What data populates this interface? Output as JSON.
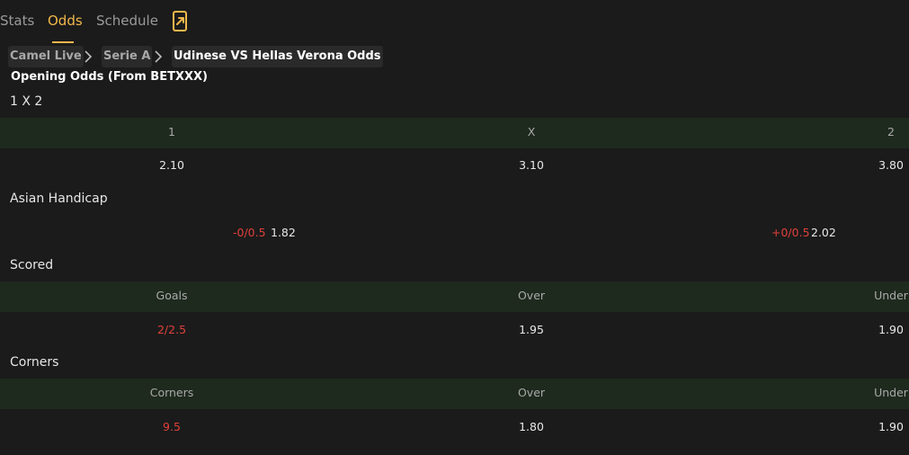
{
  "tabs": [
    {
      "label": "Stats"
    },
    {
      "label": "Odds"
    },
    {
      "label": "Schedule"
    }
  ],
  "breadcrumb": [
    "Camel Live",
    "Serie A",
    "Udinese VS Hellas Verona Odds"
  ],
  "heading": "Opening Odds (From BETXXX)",
  "sections": {
    "x12": {
      "title": "1 X 2",
      "headers": [
        "1",
        "X",
        "2"
      ],
      "values": [
        "2.10",
        "3.10",
        "3.80"
      ]
    },
    "asian_handicap": {
      "title": "Asian Handicap",
      "home_line": "-0/0.5",
      "home_odds": "1.82",
      "away_line": "+0/0.5",
      "away_odds": "2.02"
    },
    "scored": {
      "title": "Scored",
      "headers": [
        "Goals",
        "Over",
        "Under"
      ],
      "values": [
        "2/2.5",
        "1.95",
        "1.90"
      ]
    },
    "corners": {
      "title": "Corners",
      "headers": [
        "Corners",
        "Over",
        "Under"
      ],
      "values": [
        "9.5",
        "1.80",
        "1.90"
      ]
    }
  },
  "colors": {
    "accent": "#f2b84b",
    "negative": "#e0403a",
    "header_row_bg": "#1e2a1e",
    "background": "#1b1b1b"
  },
  "icons": {
    "share": "share-icon",
    "separator": "chevron-right-icon"
  }
}
